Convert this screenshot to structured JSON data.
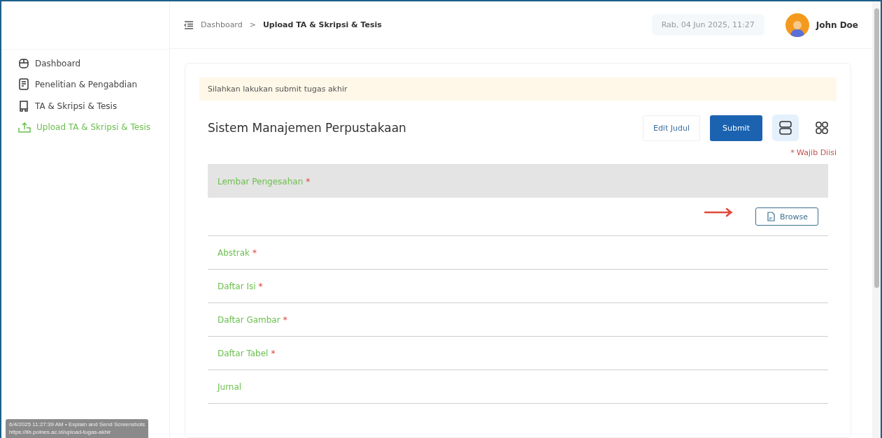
{
  "sidebar": {
    "items": [
      {
        "label": "Dashboard",
        "selected": false
      },
      {
        "label": "Penelitian & Pengabdian",
        "selected": false
      },
      {
        "label": "TA & Skripsi & Tesis",
        "selected": false
      },
      {
        "label": "Upload TA & Skripsi & Tesis",
        "selected": true
      }
    ]
  },
  "header": {
    "breadcrumb": [
      "Dashboard",
      "Upload TA & Skripsi & Tesis"
    ],
    "separator": ">",
    "datetime": "Rab, 04 Jun 2025, 11:27",
    "user": "John Doe"
  },
  "alert": "Silahkan lakukan submit tugas akhir",
  "title": "Sistem Manajemen Perpustakaan",
  "buttons": {
    "edit": "Edit Judul",
    "submit": "Submit"
  },
  "views": [
    {
      "kind": "list",
      "selected": true
    },
    {
      "kind": "grid",
      "selected": false
    }
  ],
  "required_note": "* Wajib Diisi",
  "sections": [
    {
      "label": "Lembar Pengesahan",
      "required_mark": "*",
      "expanded": true,
      "browse": "Browse"
    },
    {
      "label": "Abstrak",
      "required_mark": "*",
      "expanded": false
    },
    {
      "label": "Daftar Isi",
      "required_mark": "*",
      "expanded": false
    },
    {
      "label": "Daftar Gambar",
      "required_mark": "*",
      "expanded": false
    },
    {
      "label": "Daftar Tabel",
      "required_mark": "*",
      "expanded": false
    },
    {
      "label": "Jurnal",
      "expanded": false
    }
  ],
  "tooltip": {
    "line1": "6/4/2025 11:27:39 AM • Explain and Send Screenshots",
    "line2": "https://lib.polnes.ac.id/upload-tugas-akhir"
  }
}
